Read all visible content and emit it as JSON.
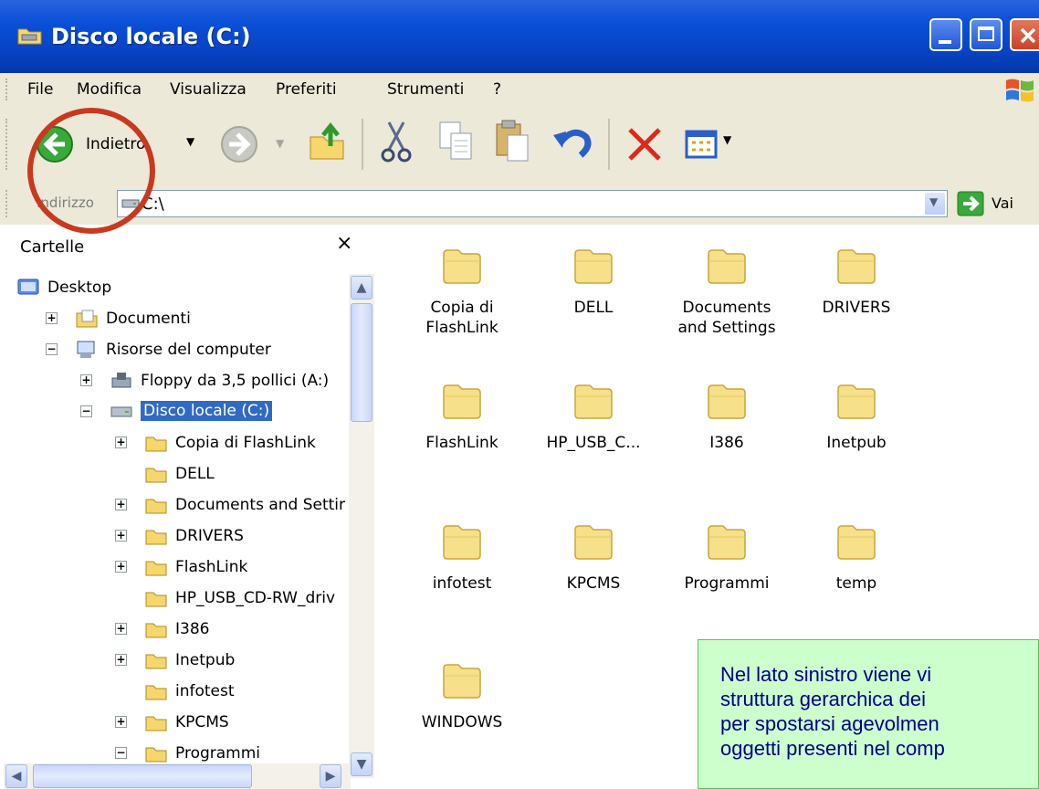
{
  "window": {
    "title": "Disco locale (C:)"
  },
  "menu": {
    "items": [
      "File",
      "Modifica",
      "Visualizza",
      "Preferiti",
      "Strumenti",
      "?"
    ]
  },
  "toolbar": {
    "back_label": "Indietro",
    "icons": [
      "back-arrow-icon",
      "forward-arrow-icon",
      "folder-up-icon",
      "cut-icon",
      "copy-icon",
      "paste-icon",
      "undo-icon",
      "delete-icon",
      "views-icon"
    ]
  },
  "address": {
    "label": "Indirizzo",
    "value": "C:\\",
    "go_label": "Vai"
  },
  "folders_pane": {
    "title": "Cartelle",
    "close": "×",
    "tree": [
      {
        "label": "Desktop",
        "icon": "desktop-icon",
        "expander": ""
      },
      {
        "label": "Documenti",
        "icon": "documents-icon",
        "expander": "+"
      },
      {
        "label": "Risorse del computer",
        "icon": "computer-icon",
        "expander": "−"
      },
      {
        "label": "Floppy da 3,5 pollici (A:)",
        "icon": "floppy-icon",
        "expander": "+"
      },
      {
        "label": "Disco locale (C:)",
        "icon": "drive-icon",
        "expander": "−",
        "selected": true
      },
      {
        "label": "Copia di FlashLink",
        "icon": "folder-icon",
        "expander": "+"
      },
      {
        "label": "DELL",
        "icon": "folder-icon",
        "expander": ""
      },
      {
        "label": "Documents and Settir",
        "icon": "folder-icon",
        "expander": "+"
      },
      {
        "label": "DRIVERS",
        "icon": "folder-icon",
        "expander": "+"
      },
      {
        "label": "FlashLink",
        "icon": "folder-icon",
        "expander": "+"
      },
      {
        "label": "HP_USB_CD-RW_driv",
        "icon": "folder-icon",
        "expander": ""
      },
      {
        "label": "I386",
        "icon": "folder-icon",
        "expander": "+"
      },
      {
        "label": "Inetpub",
        "icon": "folder-icon",
        "expander": "+"
      },
      {
        "label": "infotest",
        "icon": "folder-icon",
        "expander": ""
      },
      {
        "label": "KPCMS",
        "icon": "folder-icon",
        "expander": "+"
      },
      {
        "label": "Programmi",
        "icon": "folder-icon",
        "expander": "−"
      }
    ]
  },
  "content": {
    "folders": [
      {
        "line1": "Copia di",
        "line2": "FlashLink"
      },
      {
        "line1": "DELL",
        "line2": ""
      },
      {
        "line1": "Documents",
        "line2": "and Settings"
      },
      {
        "line1": "DRIVERS",
        "line2": ""
      },
      {
        "line1": "FlashLink",
        "line2": ""
      },
      {
        "line1": "HP_USB_C...",
        "line2": ""
      },
      {
        "line1": "I386",
        "line2": ""
      },
      {
        "line1": "Inetpub",
        "line2": ""
      },
      {
        "line1": "infotest",
        "line2": ""
      },
      {
        "line1": "KPCMS",
        "line2": ""
      },
      {
        "line1": "Programmi",
        "line2": ""
      },
      {
        "line1": "temp",
        "line2": ""
      },
      {
        "line1": "WINDOWS",
        "line2": ""
      }
    ]
  },
  "callout": {
    "lines": [
      "Nel lato sinistro viene vi",
      "struttura gerarchica dei",
      "per spostarsi agevolmen",
      "oggetti presenti nel comp"
    ]
  },
  "colors": {
    "titlebar": "#0a50d8",
    "selection": "#316ac5",
    "callout_bg": "#ccffcc",
    "callout_text": "#00008b",
    "highlight_circle": "#c8391f"
  }
}
